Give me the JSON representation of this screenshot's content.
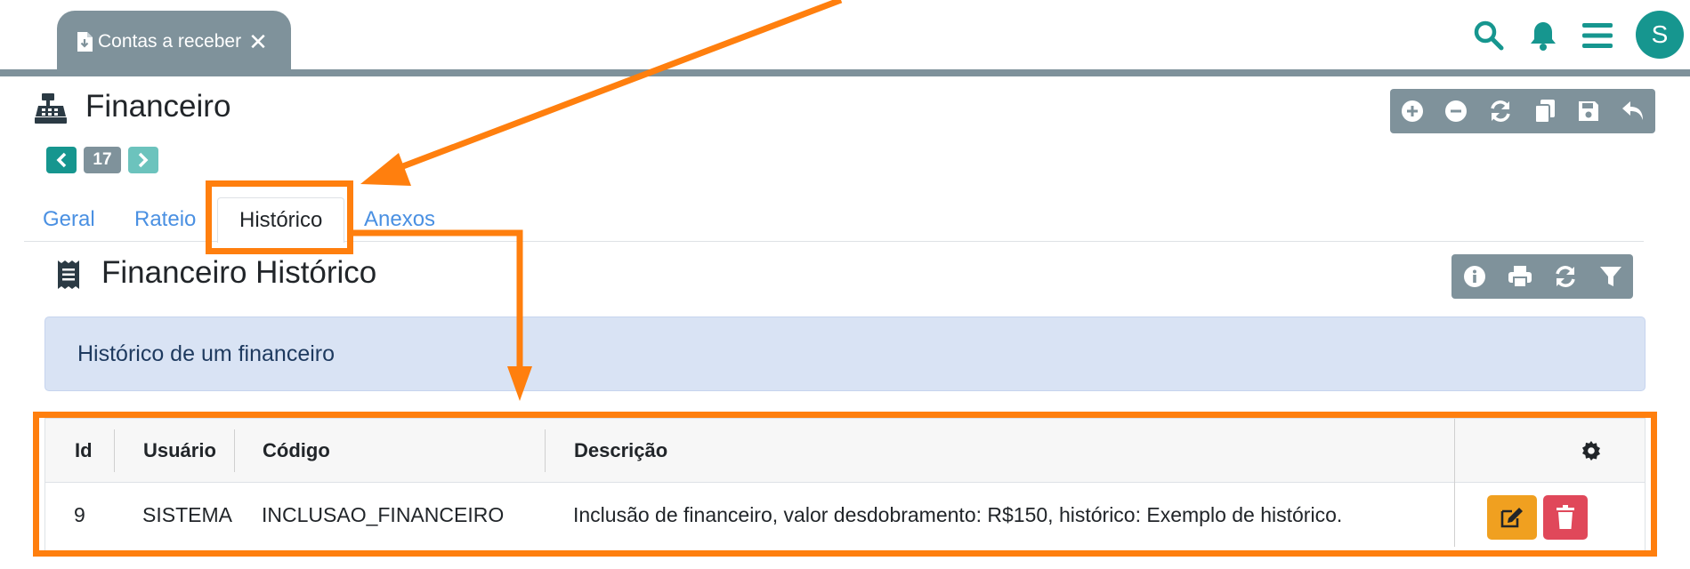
{
  "browser_tab": {
    "label": "Contas a receber",
    "doc_icon": "file-download-icon",
    "close_icon": "close-icon"
  },
  "topbar_icons": [
    "search-icon",
    "bell-icon",
    "menu-icon"
  ],
  "user": {
    "initial": "S"
  },
  "page": {
    "title": "Financeiro",
    "icon": "cash-register-icon"
  },
  "record_toolbar": [
    "add-icon",
    "remove-icon",
    "refresh-icon",
    "copy-icon",
    "save-icon",
    "undo-icon"
  ],
  "pager": {
    "current": "17"
  },
  "tabs": [
    {
      "label": "Geral"
    },
    {
      "label": "Rateio"
    },
    {
      "label": "Histórico"
    },
    {
      "label": "Anexos"
    }
  ],
  "active_tab": "Histórico",
  "section": {
    "title": "Financeiro Histórico",
    "icon": "receipt-icon"
  },
  "section_toolbar": [
    "info-icon",
    "print-icon",
    "refresh-icon",
    "filter-icon"
  ],
  "info_banner": {
    "text": "Histórico de um financeiro"
  },
  "table": {
    "columns": [
      "Id",
      "Usuário",
      "Código",
      "Descrição"
    ],
    "settings_icon": "gear-icon",
    "rows": [
      {
        "id": "9",
        "usuario": "SISTEMA",
        "codigo": "INCLUSAO_FINANCEIRO",
        "descricao": "Inclusão de financeiro, valor desdobramento: R$150, histórico: Exemplo de histórico."
      }
    ]
  },
  "colors": {
    "teal": "#16968f",
    "gray_bar": "#7f929b",
    "annotation": "#ff7f0e",
    "edit": "#f0a020",
    "delete": "#e0485a",
    "link": "#4a90e2"
  }
}
